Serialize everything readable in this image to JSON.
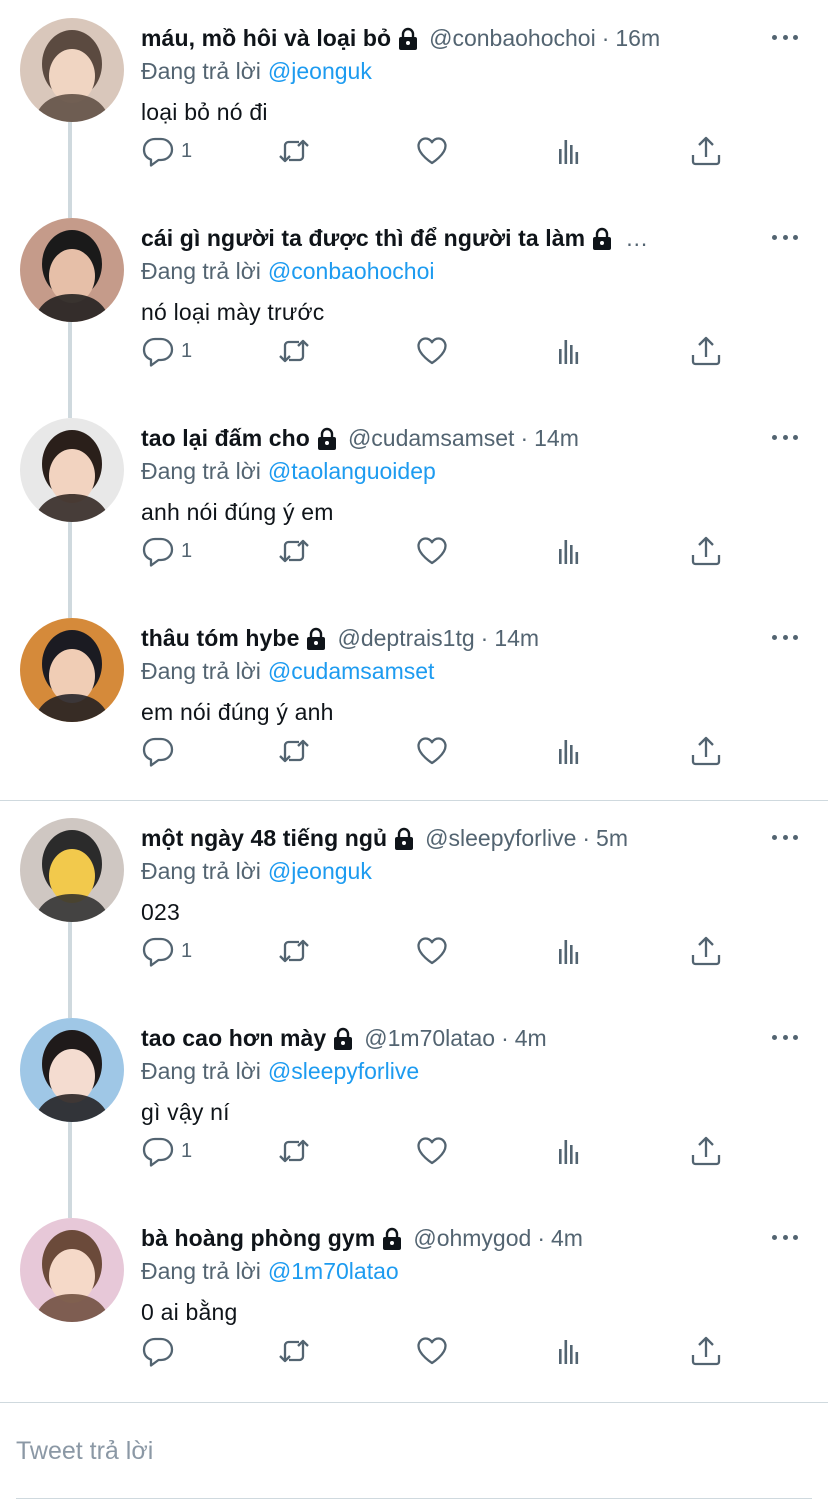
{
  "reply_prefix": "Đang trả lời",
  "tweets": [
    {
      "name": "máu, mồ hôi và loại bỏ",
      "handle": "@conbaohochoi",
      "time": "16m",
      "reply_to": "@jeonguk",
      "text": "loại bỏ nó đi",
      "reply_count": "1",
      "avatar_colors": [
        "#d9c7bb",
        "#5b4a40",
        "#f0d5c2"
      ]
    },
    {
      "name": "cái gì người ta được thì để người ta làm",
      "handle": "",
      "time": "",
      "truncated": "…",
      "reply_to": "@conbaohochoi",
      "text": "nó loại mày trước",
      "reply_count": "1",
      "avatar_colors": [
        "#c59b8a",
        "#1a1a1a",
        "#e6bfa8"
      ]
    },
    {
      "name": "tao lại đấm cho",
      "handle": "@cudamsamset",
      "time": "14m",
      "reply_to": "@taolanguoidep",
      "text": "anh nói đúng ý em",
      "reply_count": "1",
      "avatar_colors": [
        "#e8e8e8",
        "#2a1f1a",
        "#f2d3c0"
      ]
    },
    {
      "name": "thâu tóm hybe",
      "handle": "@deptrais1tg",
      "time": "14m",
      "reply_to": "@cudamsamset",
      "text": "em nói đúng ý anh",
      "reply_count": "",
      "avatar_colors": [
        "#d58a3a",
        "#1b1b22",
        "#f0cdb5"
      ]
    },
    {
      "name": "một ngày 48 tiếng ngủ",
      "handle": "@sleepyforlive",
      "time": "5m",
      "reply_to": "@jeonguk",
      "text": "023",
      "reply_count": "1",
      "avatar_colors": [
        "#cfc7c2",
        "#2b2b2b",
        "#f2c94c"
      ]
    },
    {
      "name": "tao cao hơn mày",
      "handle": "@1m70latao",
      "time": "4m",
      "reply_to": "@sleepyforlive",
      "text": "gì vậy ní",
      "reply_count": "1",
      "avatar_colors": [
        "#9fc7e6",
        "#1f1a1a",
        "#f4dcd0"
      ]
    },
    {
      "name": "bà hoàng phòng gym",
      "handle": "@ohmygod",
      "time": "4m",
      "reply_to": "@1m70latao",
      "text": "0 ai bằng",
      "reply_count": "",
      "avatar_colors": [
        "#e7c8d8",
        "#6b4a3a",
        "#f5d9c8"
      ]
    }
  ],
  "composer": {
    "placeholder": "Tweet trả lời"
  },
  "colors": {
    "link": "#1d9bf0",
    "muted": "#536471",
    "line": "#cfd9de"
  },
  "icons": [
    "lock-icon",
    "more-icon",
    "reply-icon",
    "retweet-icon",
    "like-icon",
    "stats-icon",
    "share-icon"
  ]
}
